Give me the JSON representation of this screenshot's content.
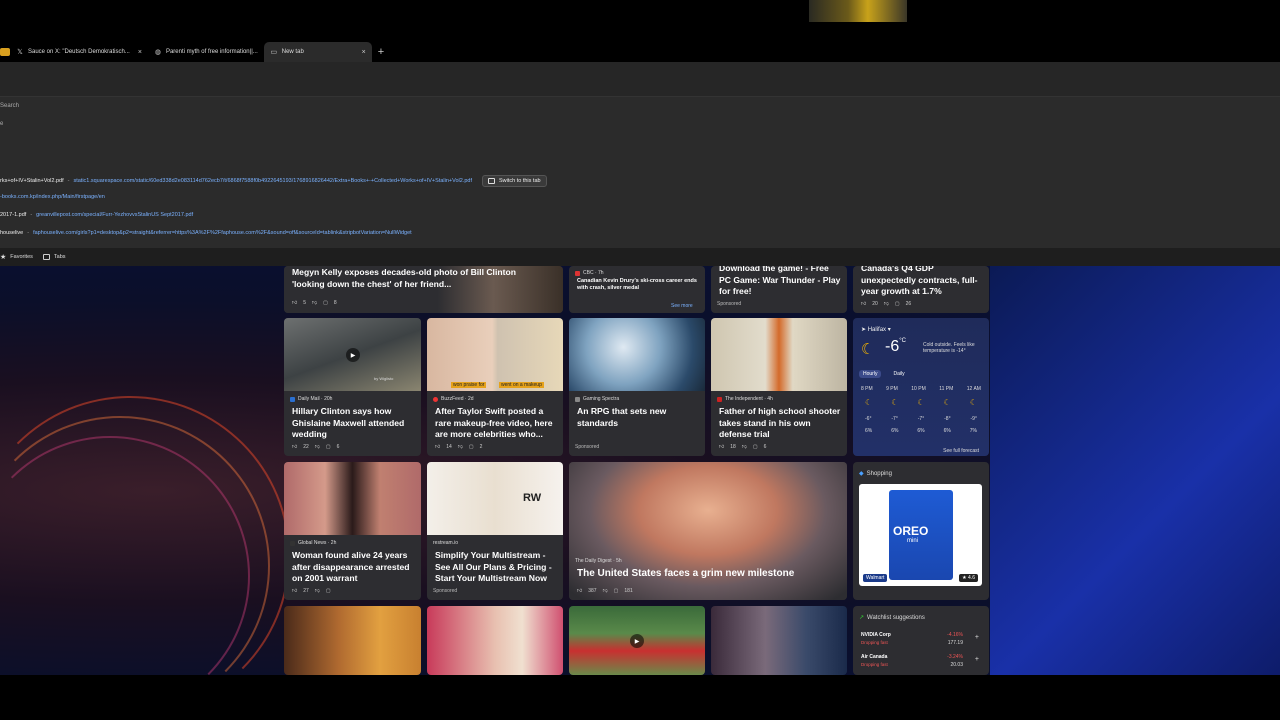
{
  "browser": {
    "tabs": [
      {
        "label": "Sauce on X: \"Deutsch Demokratisch...",
        "icon": "x-logo-icon"
      },
      {
        "label": "Parenti myth of free information||...",
        "icon": "globe-icon"
      },
      {
        "label": "New tab",
        "icon": "newtab-icon"
      }
    ],
    "new_tab_symbol": "+",
    "close_symbol": "×"
  },
  "address_dropdown": {
    "search_label": "Search",
    "sub_label": "e",
    "suggestions": [
      {
        "title": "rks+of+IV+Stalin+Vol2.pdf",
        "url": "static1.squarespace.com/static/60ed338d2e083114d762ecb7/t/6868f7588f0b4922645193/1768916826442/Extra+Books+-+Collected+Works+of+IV+Stalin+Vol2.pdf",
        "action": "Switch to this tab"
      },
      {
        "title": "",
        "url": "-books.com.kp/index.php/Main/firstpage/en",
        "action": ""
      },
      {
        "title": "2017-1.pdf",
        "url": "greanvillepost.com/special/Furr-YezhovvsStalinUS Sept2017.pdf",
        "action": ""
      },
      {
        "title": "houselive",
        "url": "faphouselive.com/girls?p1=desktop&p2=straight&referrer=https%3A%2F%2Ffaphouse.com%2F&sound=off&sourceId=tablink&stripbotVariation=NullWidget",
        "action": ""
      }
    ]
  },
  "favorites_bar": {
    "favorites_label": "Favorites",
    "tabs_label": "Tabs"
  },
  "feed": {
    "row1": [
      {
        "title": "Megyn Kelly exposes decades-old photo of Bill Clinton 'looking down the chest' of her friend...",
        "likes": "5",
        "comments": "8"
      },
      {
        "source": "CBC · 7h",
        "title": "Canadian Kevin Drury's ski-cross career ends with crash, silver medal",
        "see_more": "See more"
      },
      {
        "title": "Download the game! - Free PC Game: War Thunder - Play for free!",
        "sponsored": "Sponsored"
      },
      {
        "title": "Canada's Q4 GDP unexpectedly contracts, full-year growth at 1.7%",
        "likes": "20",
        "comments": "26"
      }
    ],
    "row2": [
      {
        "source": "Daily Mail · 20h",
        "title": "Hillary Clinton says how Ghislaine Maxwell attended wedding",
        "likes": "22",
        "comments": "6",
        "overlay": "by Wiglisto"
      },
      {
        "source": "BuzzFeed · 2d",
        "title": "After Taylor Swift posted a rare makeup-free video, here are more celebrities who...",
        "likes": "14",
        "comments": "2",
        "caption_left": "won praise for",
        "caption_right": "went on a makeup"
      },
      {
        "source": "Gaming Spectra",
        "title": "An RPG that sets new standards",
        "sponsored": "Sponsored"
      },
      {
        "source": "The Independent · 4h",
        "title": "Father of high school shooter takes stand in his own defense trial",
        "likes": "18",
        "comments": "6"
      }
    ],
    "row3": [
      {
        "source": "Global News · 2h",
        "title": "Woman found alive 24 years after disappearance arrested on 2001 warrant",
        "likes": "27",
        "comments": ""
      },
      {
        "source": "restream.io",
        "title": "Simplify Your Multistream - See All Our Plans & Pricing - Start Your Multistream Now",
        "sponsored": "Sponsored",
        "logo": "RW"
      },
      {
        "source": "The Daily Digest · 5h",
        "title": "The United States faces a grim new milestone",
        "likes": "387",
        "comments": "181"
      }
    ]
  },
  "weather": {
    "city": "Halifax",
    "temp": "-6",
    "unit": "°C",
    "desc": "Cold outside. Feels like temperature is -14°",
    "tabs": [
      "Hourly",
      "Daily"
    ],
    "hours": [
      "8 PM",
      "9 PM",
      "10 PM",
      "11 PM",
      "12 AM"
    ],
    "temps": [
      "-6°",
      "-7°",
      "-7°",
      "-8°",
      "-9°"
    ],
    "precip": [
      "6%",
      "6%",
      "6%",
      "6%",
      "7%"
    ],
    "full_forecast": "See full forecast"
  },
  "shopping": {
    "title": "Shopping",
    "store": "Walmart",
    "rating": "4.6",
    "product_brand": "OREO",
    "product_name": "mini"
  },
  "watchlist": {
    "title": "Watchlist suggestions",
    "items": [
      {
        "name": "NVIDIA Corp",
        "sub": "Dropping fast",
        "change": "-4.16%",
        "price": "177.19"
      },
      {
        "name": "Air Canada",
        "sub": "Dropping fast",
        "change": "-3.24%",
        "price": "20.03"
      }
    ]
  },
  "colors": {
    "panel_bg": "#2b2b2b",
    "card_bg": "#2d2d31",
    "link_blue": "#7bb2ff",
    "accent_orange": "#f4b400",
    "down_red": "#e55555"
  }
}
